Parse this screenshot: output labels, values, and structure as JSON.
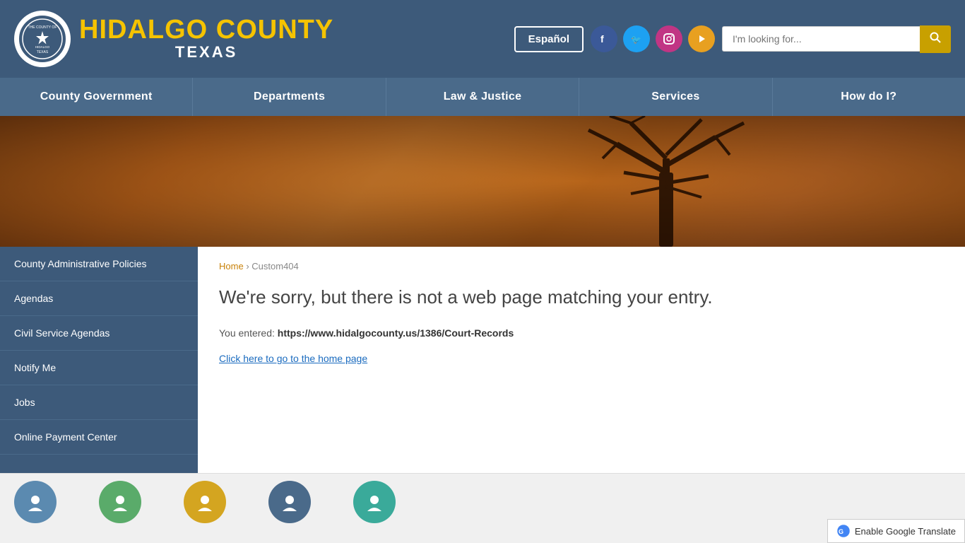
{
  "header": {
    "site_name": "HIDALGO COUNTY",
    "site_sub": "TEXAS",
    "espanol_label": "Español",
    "search_placeholder": "I'm looking for...",
    "search_btn_icon": "🔍"
  },
  "social": [
    {
      "name": "facebook",
      "icon": "f",
      "class": "facebook"
    },
    {
      "name": "twitter",
      "icon": "t",
      "class": "twitter"
    },
    {
      "name": "instagram",
      "icon": "📷",
      "class": "instagram"
    },
    {
      "name": "youtube",
      "icon": "▶",
      "class": "youtube"
    }
  ],
  "nav": {
    "items": [
      {
        "label": "County Government",
        "id": "county-government"
      },
      {
        "label": "Departments",
        "id": "departments"
      },
      {
        "label": "Law & Justice",
        "id": "law-justice"
      },
      {
        "label": "Services",
        "id": "services"
      },
      {
        "label": "How do I?",
        "id": "how-do-i"
      }
    ]
  },
  "sidebar": {
    "items": [
      {
        "label": "County Administrative Policies",
        "id": "admin-policies"
      },
      {
        "label": "Agendas",
        "id": "agendas"
      },
      {
        "label": "Civil Service Agendas",
        "id": "civil-service-agendas"
      },
      {
        "label": "Notify Me",
        "id": "notify-me"
      },
      {
        "label": "Jobs",
        "id": "jobs"
      },
      {
        "label": "Online Payment Center",
        "id": "online-payment"
      }
    ]
  },
  "breadcrumb": {
    "home_label": "Home",
    "separator": "›",
    "current": "Custom404"
  },
  "error_page": {
    "heading": "We're sorry, but there is not a web page matching your entry.",
    "you_entered_prefix": "You entered: ",
    "url": "https://www.hidalgocounty.us/1386/Court-Records",
    "home_link_label": "Click here to go to the home page"
  },
  "google_translate": {
    "label": "Enable Google Translate"
  }
}
